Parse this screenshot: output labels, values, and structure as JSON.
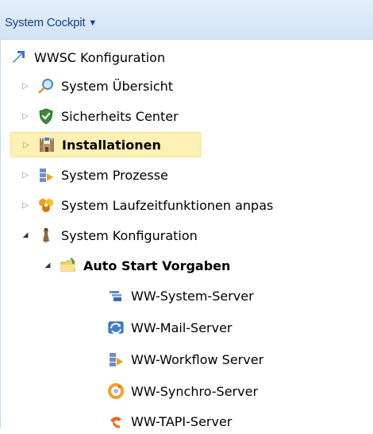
{
  "header": {
    "title": "System Cockpit",
    "caret": "▼"
  },
  "tree": {
    "root": {
      "label": "WWSC Konfiguration",
      "icon": "arrow-icon"
    },
    "items": [
      {
        "label": "System Übersicht",
        "icon": "magnifier-icon",
        "expander": "▷"
      },
      {
        "label": "Sicherheits Center",
        "icon": "shield-icon",
        "expander": "▷"
      },
      {
        "label": "Installationen",
        "icon": "castle-icon",
        "expander": "▷"
      },
      {
        "label": "System Prozesse",
        "icon": "process-icon",
        "expander": "▷"
      },
      {
        "label": "System Laufzeitfunktionen anpas",
        "icon": "puzzle-icon",
        "expander": "▷"
      },
      {
        "label": "System Konfiguration",
        "icon": "wrench-icon",
        "expander": "◢"
      },
      {
        "label": "Auto Start Vorgaben",
        "icon": "folder-icon",
        "expander": "◢"
      }
    ],
    "servers": [
      {
        "label": "WW-System-Server",
        "icon": "server-icon"
      },
      {
        "label": "WW-Mail-Server",
        "icon": "mail-server-icon"
      },
      {
        "label": "WW-Workflow Server",
        "icon": "workflow-icon"
      },
      {
        "label": "WW-Synchro-Server",
        "icon": "sync-icon"
      },
      {
        "label": "WW-TAPI-Server",
        "icon": "phone-icon"
      }
    ]
  },
  "colors": {
    "header_bg": "#d3e3f5",
    "header_text": "#15428b",
    "selected_bg": "#fff0b5"
  }
}
